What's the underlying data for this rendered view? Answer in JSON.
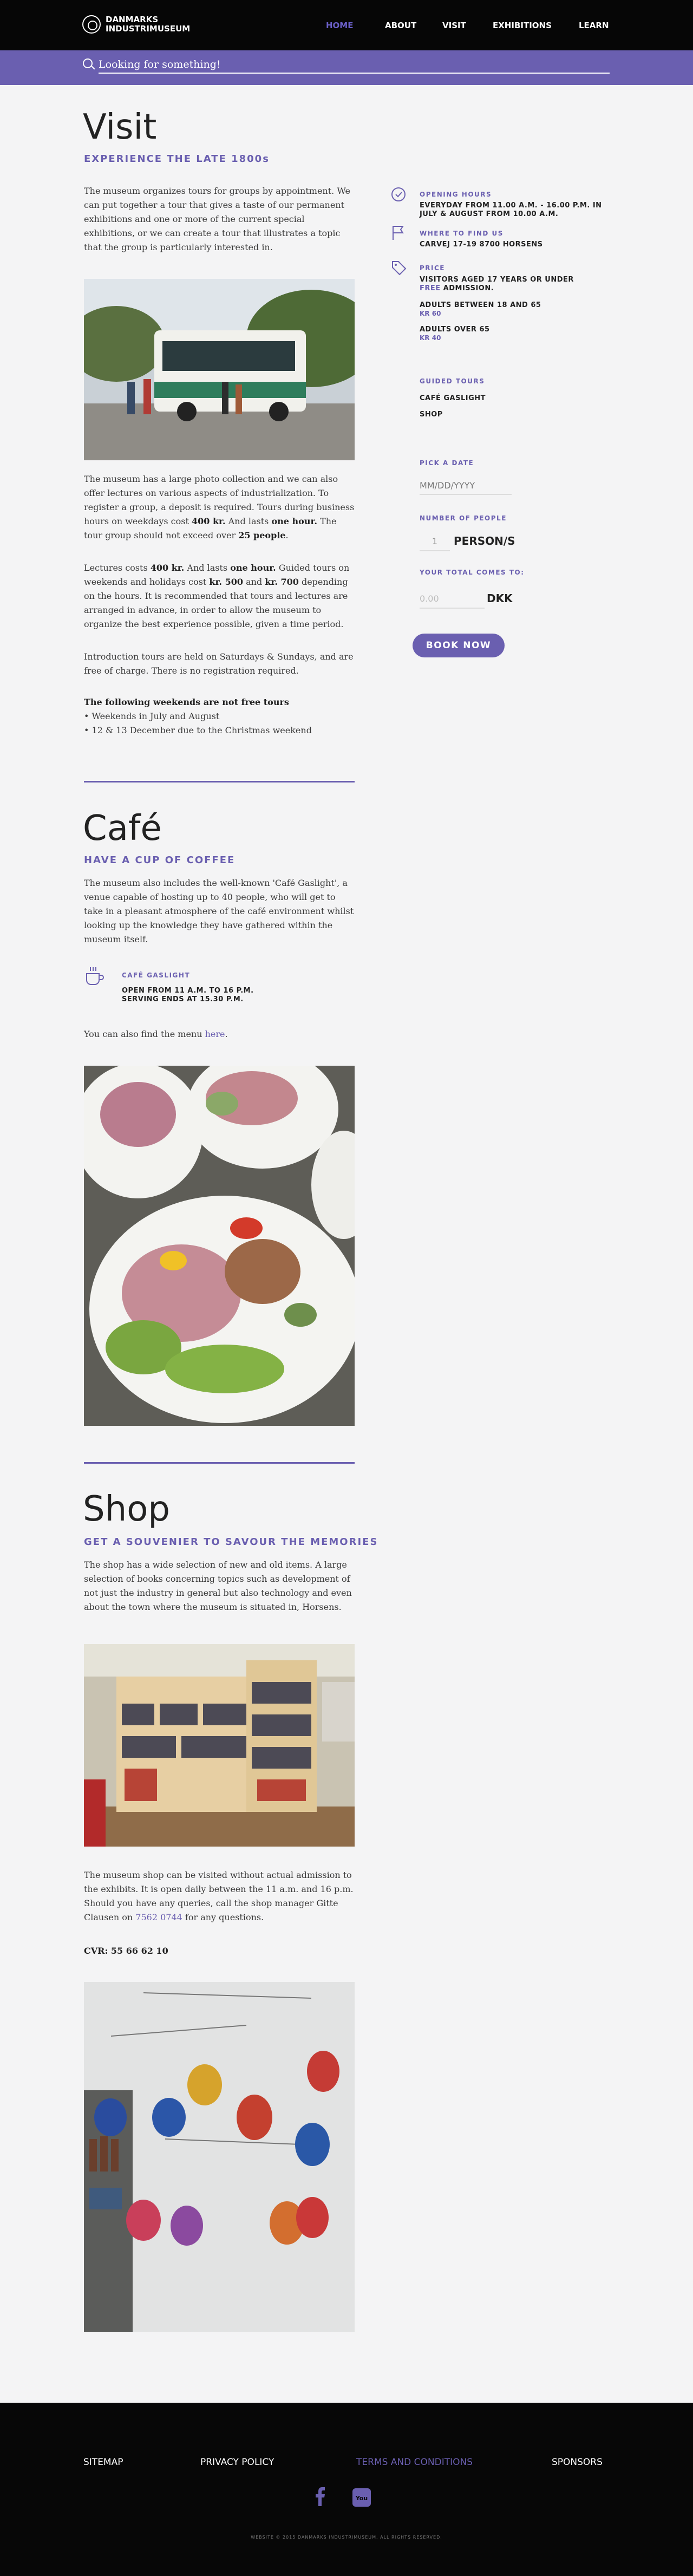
{
  "site": {
    "logo": "DANMARKS\nINDUSTRIMUSEUM",
    "nav": [
      "HOME",
      "ABOUT",
      "VISIT",
      "EXHIBITIONS",
      "LEARN"
    ],
    "search_placeholder": "Looking for something!"
  },
  "visit": {
    "title": "Visit",
    "subtitle": "EXPERIENCE THE LATE 1800s",
    "intro": "The museum organizes tours for groups by appointment. We can put together a tour that gives a taste of our permanent exhibitions and one or more of the current special exhibitions, or we can create a tour that illustrates a topic that the group is particularly interested in.",
    "p2_a": "The museum has a large photo collection and we can also offer lectures on various aspects of industrialization. To register a group, a deposit is required. Tours during business hours on weekdays cost ",
    "p2_b": "400 kr.",
    "p2_c": " And lasts ",
    "p2_d": "one hour.",
    "p2_e": " The tour group should not exceed over ",
    "p2_f": "25 people",
    "p2_g": ".",
    "p3_a": "Lectures costs ",
    "p3_b": "400 kr.",
    "p3_c": " And lasts ",
    "p3_d": "one hour.",
    "p3_e": " Guided tours on weekends and holidays cost ",
    "p3_f": "kr. 500",
    "p3_g": " and ",
    "p3_h": "kr. 700",
    "p3_i": " depending on the hours. It is recommended that tours and lectures are arranged in advance, in order to allow the museum to organize the best experience possible, given a time period.",
    "p4": "Introduction tours are held on Saturdays & Sundays, and are free of charge. There is no registration required.",
    "nofree_title": "The following weekends are not free tours",
    "nofree_1": "• Weekends in July and August",
    "nofree_2": "• 12 & 13 December due to the Christmas weekend"
  },
  "sidebar": {
    "hours_label": "OPENING HOURS",
    "hours_text": "EVERYDAY FROM 11.00 A.M. - 16.00 P.M. IN JULY & AUGUST FROM 10.00 A.M.",
    "find_label": "WHERE TO FIND US",
    "find_text": "CARVEJ 17-19 8700 HORSENS",
    "price_label": "PRICE",
    "price_1a": "VISITORS AGED 17 YEARS OR UNDER",
    "price_1b": "FREE",
    "price_1c": " ADMISSION.",
    "price_2": "ADULTS BETWEEN 18 AND 65",
    "price_2v": "KR 60",
    "price_3": "ADULTS OVER 65",
    "price_3v": "KR 40",
    "guided_label": "GUIDED TOURS",
    "guided_1": "CAFÉ GASLIGHT",
    "guided_2": "SHOP",
    "date_label": "PICK A DATE",
    "date_placeholder": "MM/DD/YYYY",
    "people_label": "NUMBER OF PEOPLE",
    "people_value": "1",
    "people_unit": "PERSON/S",
    "total_label": "YOUR TOTAL COMES TO:",
    "total_value": "0.00",
    "total_unit": "DKK",
    "book_label": "BOOK NOW"
  },
  "cafe": {
    "title": "Café",
    "subtitle": "HAVE A CUP OF COFFEE",
    "intro": "The museum also includes the well-known 'Café Gaslight', a venue capable of hosting up to 40 people, who will get to take in a pleasant atmosphere of the café environment whilst looking up the knowledge they have gathered within the museum itself.",
    "name": "CAFÉ GASLIGHT",
    "hours_1": "OPEN FROM 11 A.M. TO 16 P.M.",
    "hours_2": "SERVING ENDS AT 15.30 P.M.",
    "menu_a": "You can also find the menu ",
    "menu_link": "here",
    "menu_b": "."
  },
  "shop": {
    "title": "Shop",
    "subtitle": "GET A SOUVENIER TO SAVOUR THE MEMORIES",
    "intro": "The shop has a wide selection of new and old items. A large selection of books concerning topics such as development of not just the industry in general but also technology and even about the town where the museum is situated in, Horsens.",
    "p2_a": "The museum shop can be visited without actual admission to the exhibits. It is open daily between the 11 a.m. and 16 p.m. Should you have any queries, call the shop manager Gitte Clausen on ",
    "phone": "7562 0744",
    "p2_b": " for any questions.",
    "cvr": "CVR: 55 66 62 10"
  },
  "footer": {
    "links": [
      "SITEMAP",
      "PRIVACY POLICY",
      "TERMS AND CONDITIONS",
      "SPONSORS"
    ],
    "copyright": "WEBSITE © 2015 DANMARKS INDUSTRIMUSEUM. ALL RIGHTS RESERVED."
  },
  "colors": {
    "accent": "#6a5fb0",
    "dark": "#060606",
    "bg": "#f4f4f5"
  }
}
